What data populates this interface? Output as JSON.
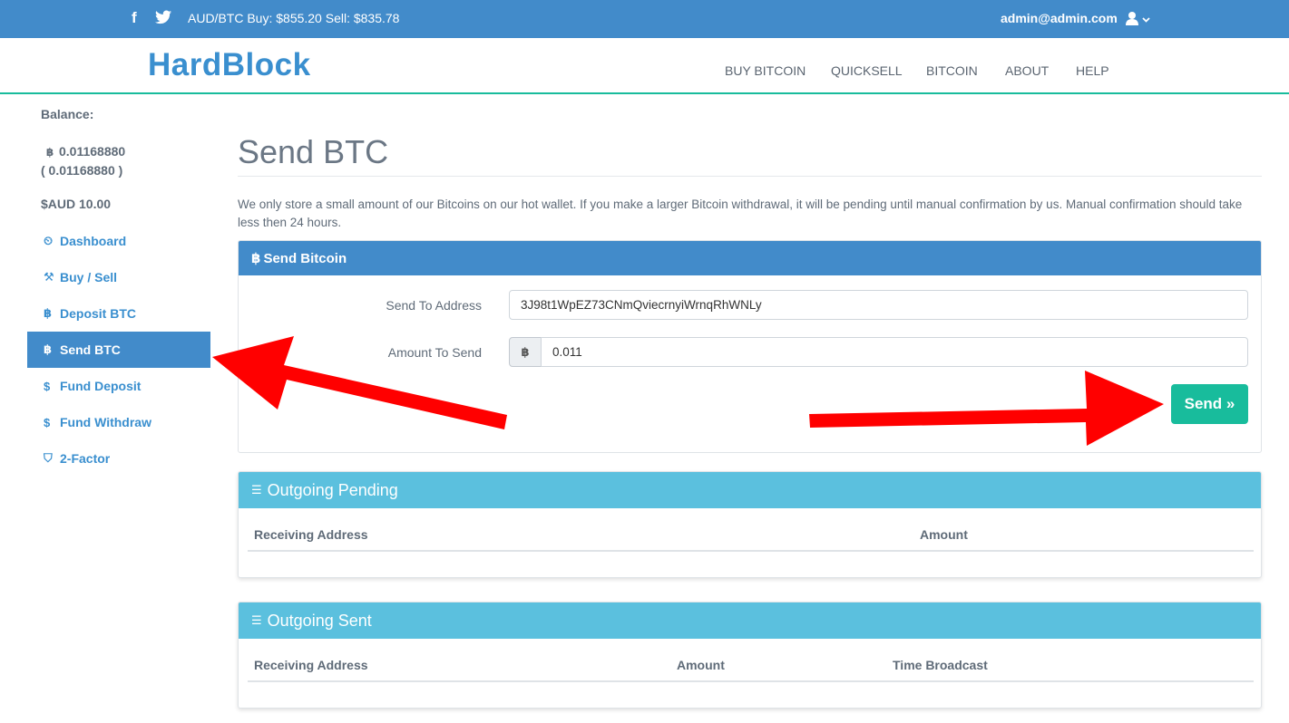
{
  "topbar": {
    "facebook_icon": "f",
    "price_text": "AUD/BTC Buy: $855.20  Sell: $835.78",
    "user_email": "admin@admin.com"
  },
  "navbar": {
    "brand": "HardBlock",
    "links": [
      "BUY BITCOIN",
      "QUICKSELL",
      "BITCOIN",
      "ABOUT",
      "HELP"
    ]
  },
  "sidebar": {
    "balance_label": "Balance:",
    "btc_balance": "0.01168880",
    "btc_balance_paren": "( 0.01168880 )",
    "aud_balance": "$AUD 10.00",
    "items": [
      {
        "label": "Dashboard",
        "icon": "dashboard-icon",
        "glyph": "⏲"
      },
      {
        "label": "Buy / Sell",
        "icon": "gavel-icon",
        "glyph": "⚒"
      },
      {
        "label": "Deposit BTC",
        "icon": "bitcoin-icon",
        "glyph": "฿"
      },
      {
        "label": "Send BTC",
        "icon": "bitcoin-icon",
        "glyph": "฿"
      },
      {
        "label": "Fund Deposit",
        "icon": "dollar-icon",
        "glyph": "$"
      },
      {
        "label": "Fund Withdraw",
        "icon": "dollar-icon",
        "glyph": "$"
      },
      {
        "label": "2-Factor",
        "icon": "shield-icon",
        "glyph": "⛉"
      }
    ],
    "active_item": "Send BTC"
  },
  "main": {
    "title": "Send BTC",
    "description": "We only store a small amount of our Bitcoins on our hot wallet. If you make a larger Bitcoin withdrawal, it will be pending until manual confirmation by us. Manual confirmation should take less then 24 hours.",
    "send_panel": {
      "heading": "Send Bitcoin",
      "address_label": "Send To Address",
      "address_value": "3J98t1WpEZ73CNmQviecrnyiWrnqRhWNLy",
      "amount_label": "Amount To Send",
      "amount_addon": "฿",
      "amount_value": "0.011",
      "send_button": "Send »"
    },
    "pending_panel": {
      "heading": "Outgoing Pending",
      "columns": [
        "Receiving Address",
        "Amount"
      ]
    },
    "sent_panel": {
      "heading": "Outgoing Sent",
      "columns": [
        "Receiving Address",
        "Amount",
        "Time Broadcast"
      ]
    }
  },
  "colors": {
    "topbar": "#428bca",
    "brand": "#3a8fcf",
    "success": "#18bc9c",
    "info": "#5bc0de",
    "annotation_arrow": "#ff0000"
  }
}
